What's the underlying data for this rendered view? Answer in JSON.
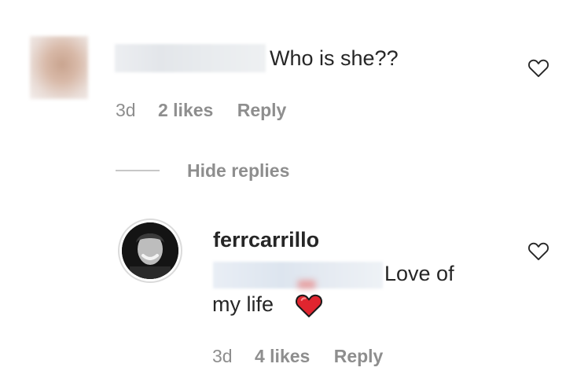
{
  "comments": [
    {
      "text": "Who is she??",
      "time": "3d",
      "likes": "2 likes",
      "reply_label": "Reply"
    }
  ],
  "replies_toggle": "Hide replies",
  "reply": {
    "username": "ferrcarrillo",
    "text_line1": "Love of",
    "text_line2": "my life",
    "emoji": "red-heart",
    "time": "3d",
    "likes": "4 likes",
    "reply_label": "Reply"
  },
  "colors": {
    "text": "#262626",
    "meta": "#8e8e8e",
    "heart_emoji": "#e0252f"
  }
}
